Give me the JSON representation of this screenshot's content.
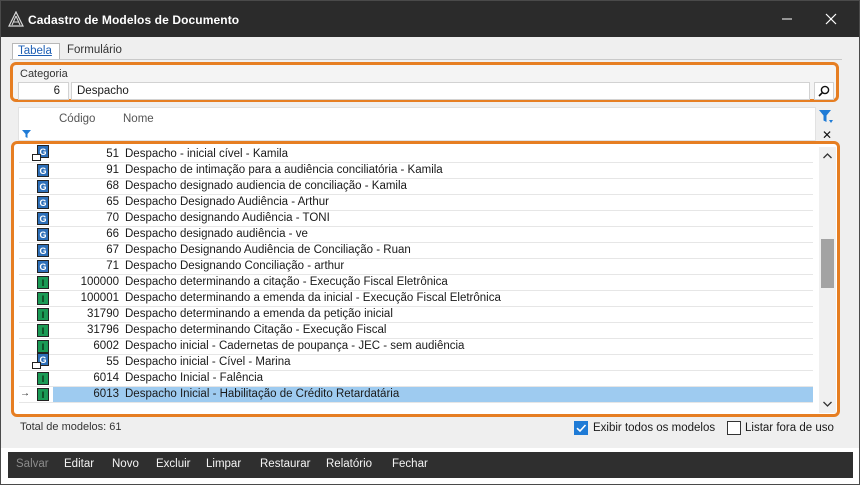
{
  "window": {
    "title": "Cadastro de Modelos de Documento",
    "minimize_label": "—",
    "close_label": "✕"
  },
  "tabs": [
    {
      "label": "Tabela",
      "active": true
    },
    {
      "label": "Formulário",
      "active": false
    }
  ],
  "category": {
    "label": "Categoria",
    "code": "6",
    "name": "Despacho"
  },
  "grid": {
    "header_code": "Código",
    "header_name": "Nome",
    "rows": [
      {
        "type": "G-link",
        "code": "51",
        "name": "Despacho - inicial cível - Kamila"
      },
      {
        "type": "G",
        "code": "91",
        "name": "Despacho de intimação para a audiência conciliatória - Kamila"
      },
      {
        "type": "G",
        "code": "68",
        "name": "Despacho designado audiencia de conciliação - Kamila"
      },
      {
        "type": "G",
        "code": "65",
        "name": "Despacho Designado Audiência -  Arthur"
      },
      {
        "type": "G",
        "code": "70",
        "name": "Despacho designando Audiência - TONI"
      },
      {
        "type": "G",
        "code": "66",
        "name": "Despacho designado audiência - ve"
      },
      {
        "type": "G",
        "code": "67",
        "name": "Despacho Designando Audiência de Conciliação - Ruan"
      },
      {
        "type": "G",
        "code": "71",
        "name": "Despacho Designando Conciliação - arthur"
      },
      {
        "type": "I",
        "code": "100000",
        "name": "Despacho determinando a citação - Execução Fiscal Eletrônica"
      },
      {
        "type": "I",
        "code": "100001",
        "name": "Despacho determinando a emenda da inicial - Execução Fiscal Eletrônica"
      },
      {
        "type": "I",
        "code": "31790",
        "name": "Despacho determinando a emenda da petição inicial"
      },
      {
        "type": "I",
        "code": "31796",
        "name": "Despacho determinando Citação - Execução Fiscal"
      },
      {
        "type": "I",
        "code": "6002",
        "name": "Despacho inicial - Cadernetas de poupança - JEC - sem audiência"
      },
      {
        "type": "G-link",
        "code": "55",
        "name": "Despacho inicial - Cível - Marina"
      },
      {
        "type": "I",
        "code": "6014",
        "name": "Despacho Inicial - Falência"
      },
      {
        "type": "I",
        "code": "6013",
        "name": "Despacho Inicial - Habilitação de Crédito Retardatária",
        "selected": true
      }
    ],
    "scroll_position": 0.41
  },
  "footer": {
    "total_label": "Total de modelos: 61",
    "show_all_label": "Exibir todos os modelos",
    "show_all_checked": true,
    "out_of_use_label": "Listar fora de uso",
    "out_of_use_checked": false
  },
  "toolbar": {
    "buttons": [
      {
        "label": "Salvar",
        "enabled": false
      },
      {
        "label": "Editar",
        "enabled": true
      },
      {
        "label": "Novo",
        "enabled": true
      },
      {
        "label": "Excluir",
        "enabled": true
      },
      {
        "label": "Limpar",
        "enabled": true
      },
      {
        "label": "Restaurar",
        "enabled": true
      },
      {
        "label": "Relatório",
        "enabled": true
      },
      {
        "label": "Fechar",
        "enabled": true
      }
    ]
  },
  "colors": {
    "highlight_border": "#e67e22",
    "selected_row": "#9ecbf0",
    "badge_g": "#2d6fb8",
    "badge_i": "#1a9a55"
  },
  "icons": {
    "app": "app-logo-icon",
    "search": "search-icon",
    "filter": "filter-icon",
    "clear_filter": "clear-filter-icon",
    "row_pointer": "row-pointer-icon"
  }
}
